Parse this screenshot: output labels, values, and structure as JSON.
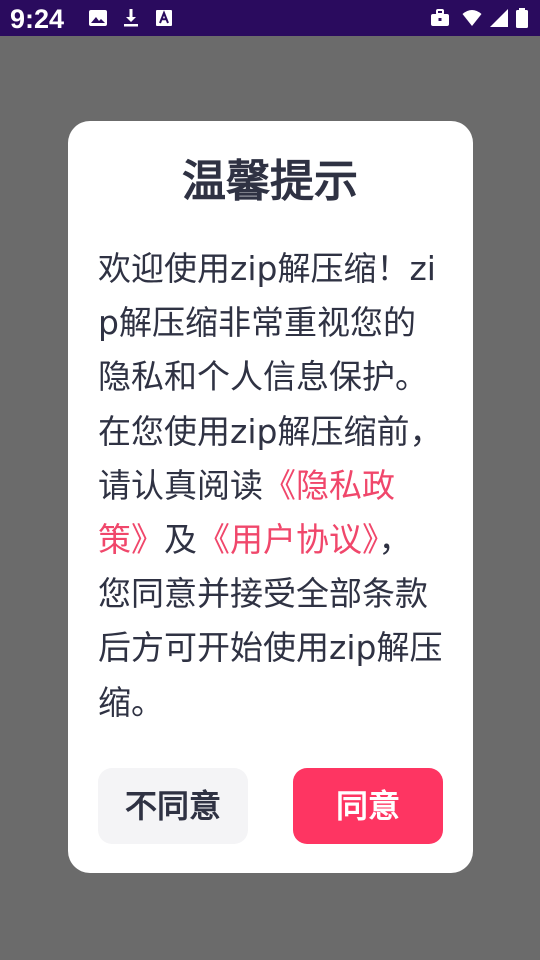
{
  "status_bar": {
    "time": "9:24",
    "left_icons": [
      "image-icon",
      "download-icon",
      "text-a-icon"
    ],
    "right_icons": [
      "briefcase-icon",
      "wifi-icon",
      "signal-icon",
      "battery-icon"
    ],
    "background": "#2a0b5e"
  },
  "dialog": {
    "title": "温馨提示",
    "body": {
      "p1": "欢迎使用zip解压缩！zip解压缩非常重视您的隐私和个人信息保护。在您使用zip解压缩前，请认真阅读",
      "privacy_link": "《隐私政策》",
      "and": "及",
      "agreement_link": "《用户协议》",
      "p2": "，您同意并接受全部条款后方可开始使用zip解压缩。"
    },
    "buttons": {
      "disagree": "不同意",
      "agree": "同意"
    }
  },
  "colors": {
    "overlay": "#6b6b6b",
    "text": "#2f3243",
    "link": "#f0476b",
    "accent": "#fe3562",
    "secondary_button": "#f4f4f6"
  }
}
